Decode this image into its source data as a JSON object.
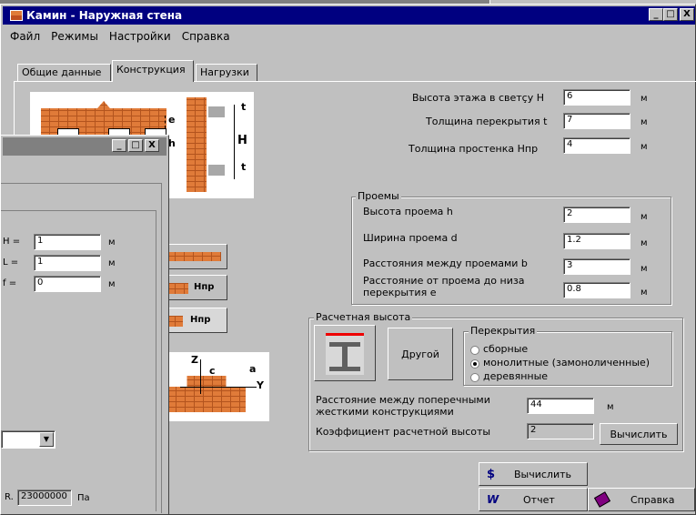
{
  "main_window": {
    "title": "Камин - Наружная стена",
    "controls": {
      "minimize": "_",
      "maximize": "□",
      "close": "X"
    }
  },
  "menu": [
    "Файл",
    "Режимы",
    "Настройки",
    "Справка"
  ],
  "tabs": [
    "Общие данные",
    "Конструкция",
    "Нагрузки"
  ],
  "active_tab": "Конструкция",
  "diagram_labels": {
    "e": "e",
    "h": "h",
    "H": "H",
    "t_top": "t",
    "t_bottom": "t"
  },
  "floor_fields": [
    {
      "label": "Высота этажа в светçу H",
      "value": "6",
      "unit": "м"
    },
    {
      "label": "Толщина перекрытия t",
      "value": "7",
      "unit": "м"
    },
    {
      "label": "Толщина простенка Hпр",
      "value": "4",
      "unit": "м"
    }
  ],
  "openings": {
    "title": "Проемы",
    "fields": [
      {
        "label": "Высота проема h",
        "value": "2",
        "unit": "м"
      },
      {
        "label": "Ширина проема d",
        "value": "1.2",
        "unit": "м"
      },
      {
        "label": "Расстояния между проемами b",
        "value": "3",
        "unit": "м"
      },
      {
        "label": "Расстояние от проема до низа перекрытия e",
        "value": "0.8",
        "unit": "м"
      }
    ]
  },
  "calc_height": {
    "title": "Расчетная высота",
    "other_button": "Другой",
    "slabs_title": "Перекрытия",
    "slab_options": [
      "сборные",
      "монолитные (замоноличенные)",
      "деревянные"
    ],
    "selected_slab": 1,
    "stiff_label": "Расстояние между поперечными жесткими конструкциями",
    "stiff_value": "44",
    "stiff_unit": "м",
    "coef_label": "Коэффициент расчетной высоты",
    "coef_value": "2",
    "calc_button": "Вычислить"
  },
  "bottom_buttons": {
    "calc": "Вычислить",
    "report": "Отчет",
    "help": "Справка"
  },
  "section_icons": {
    "label1": "Hпр",
    "label2": "Hпр"
  },
  "profile_labels": {
    "z": "Z",
    "c": "c",
    "a": "a",
    "y": "Y"
  },
  "back_window": {
    "controls": {
      "minimize": "_",
      "maximize": "□",
      "close": "X"
    },
    "fields": [
      {
        "label": "H =",
        "value": "1",
        "unit": "м"
      },
      {
        "label": "L =",
        "value": "1",
        "unit": "м"
      },
      {
        "label": "f =",
        "value": "0",
        "unit": "м"
      }
    ],
    "modulus_label": "R.",
    "modulus_value": "23000000",
    "modulus_unit": "Па"
  },
  "colors": {
    "titlebar": "#000080",
    "face": "#c0c0c0",
    "brick": "#e07b39"
  }
}
